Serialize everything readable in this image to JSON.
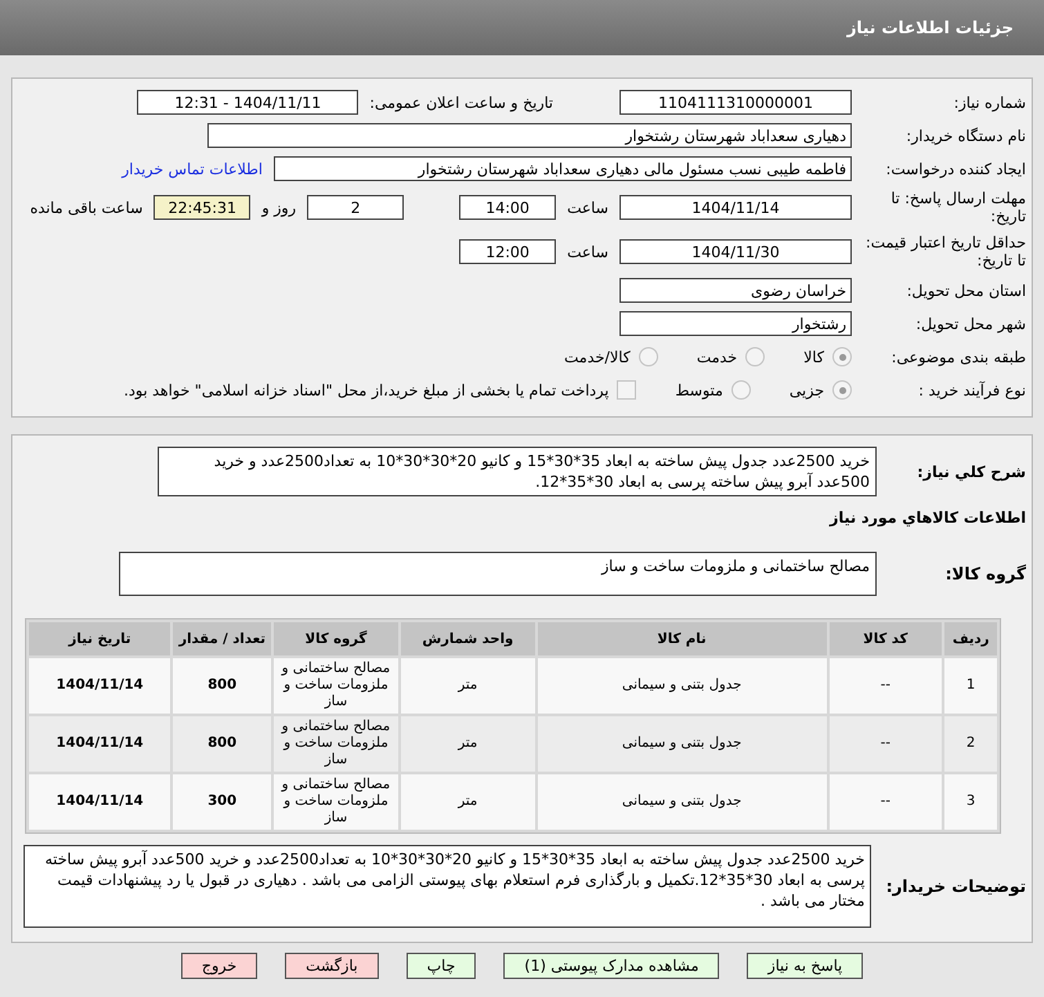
{
  "header": {
    "title": "جزئیات اطلاعات نیاز"
  },
  "need_number": {
    "label": "شماره نیاز:",
    "value": "1104111310000001"
  },
  "announce": {
    "label": "تاریخ و ساعت اعلان عمومی:",
    "value": "1404/11/11 - 12:31"
  },
  "buyer_org": {
    "label": "نام دستگاه خریدار:",
    "value": "دهیاری سعداباد شهرستان رشتخوار"
  },
  "requester": {
    "label": "ایجاد کننده درخواست:",
    "value": "فاطمه طیبی نسب مسئول مالی دهیاری سعداباد شهرستان رشتخوار",
    "link": "اطلاعات تماس خریدار"
  },
  "deadline": {
    "label": "مهلت ارسال پاسخ: تا تاریخ:",
    "date": "1404/11/14",
    "time_label": "ساعت",
    "time": "14:00",
    "days": "2",
    "days_label": "روز و",
    "remaining": "22:45:31",
    "remaining_label": "ساعت باقی مانده"
  },
  "validity": {
    "label": "حداقل تاریخ اعتبار قیمت: تا تاریخ:",
    "date": "1404/11/30",
    "time_label": "ساعت",
    "time": "12:00"
  },
  "province": {
    "label": "استان محل تحویل:",
    "value": "خراسان رضوی"
  },
  "city": {
    "label": "شهر محل تحویل:",
    "value": "رشتخوار"
  },
  "category": {
    "label": "طبقه بندی موضوعی:",
    "options": [
      {
        "label": "کالا",
        "selected": true
      },
      {
        "label": "خدمت",
        "selected": false
      },
      {
        "label": "کالا/خدمت",
        "selected": false
      }
    ]
  },
  "process": {
    "label": "نوع فرآیند خرید :",
    "options": [
      {
        "label": "جزیی",
        "selected": true
      },
      {
        "label": "متوسط",
        "selected": false
      }
    ],
    "treasury": {
      "label": "پرداخت تمام یا بخشی از مبلغ خرید،از محل \"اسناد خزانه اسلامی\" خواهد بود.",
      "checked": false
    }
  },
  "description": {
    "label": "شرح کلي نياز:",
    "value": "خرید 2500عدد جدول پیش ساخته به ابعاد 35*30*15 و کانیو 20*30*30*10 به تعداد2500عدد و خرید 500عدد آبرو پیش ساخته پرسی به ابعاد 30*35*12."
  },
  "items_title": "اطلاعات کالاهاي مورد نياز",
  "goods_group": {
    "label": "گروه کالا:",
    "value": "مصالح ساختمانی و ملزومات ساخت و ساز"
  },
  "table": {
    "columns": [
      "ردیف",
      "کد کالا",
      "نام کالا",
      "واحد شمارش",
      "گروه کالا",
      "تعداد / مقدار",
      "تاریخ نیاز"
    ],
    "rows": [
      [
        "1",
        "--",
        "جدول بتنی و سیمانی",
        "متر",
        "مصالح ساختمانی و ملزومات ساخت و ساز",
        "800",
        "1404/11/14"
      ],
      [
        "2",
        "--",
        "جدول بتنی و سیمانی",
        "متر",
        "مصالح ساختمانی و ملزومات ساخت و ساز",
        "800",
        "1404/11/14"
      ],
      [
        "3",
        "--",
        "جدول بتنی و سیمانی",
        "متر",
        "مصالح ساختمانی و ملزومات ساخت و ساز",
        "300",
        "1404/11/14"
      ]
    ]
  },
  "buyer_notes": {
    "label": "توضیحات خریدار:",
    "value": "خرید 2500عدد جدول پیش ساخته به ابعاد 35*30*15 و کانیو 20*30*30*10 به تعداد2500عدد و خرید 500عدد آبرو پیش ساخته پرسی به ابعاد 30*35*12.تکمیل و بارگذاری فرم استعلام بهای پیوستی الزامی می باشد . دهیاری در قبول یا رد پیشنهادات قیمت مختار می باشد ."
  },
  "buttons": [
    {
      "label": "پاسخ به نیاز",
      "kind": "normal"
    },
    {
      "label": "مشاهده مدارک پیوستی (1)",
      "kind": "normal"
    },
    {
      "label": "چاپ",
      "kind": "normal"
    },
    {
      "label": "بازگشت",
      "kind": "danger"
    },
    {
      "label": "خروج",
      "kind": "danger"
    }
  ]
}
